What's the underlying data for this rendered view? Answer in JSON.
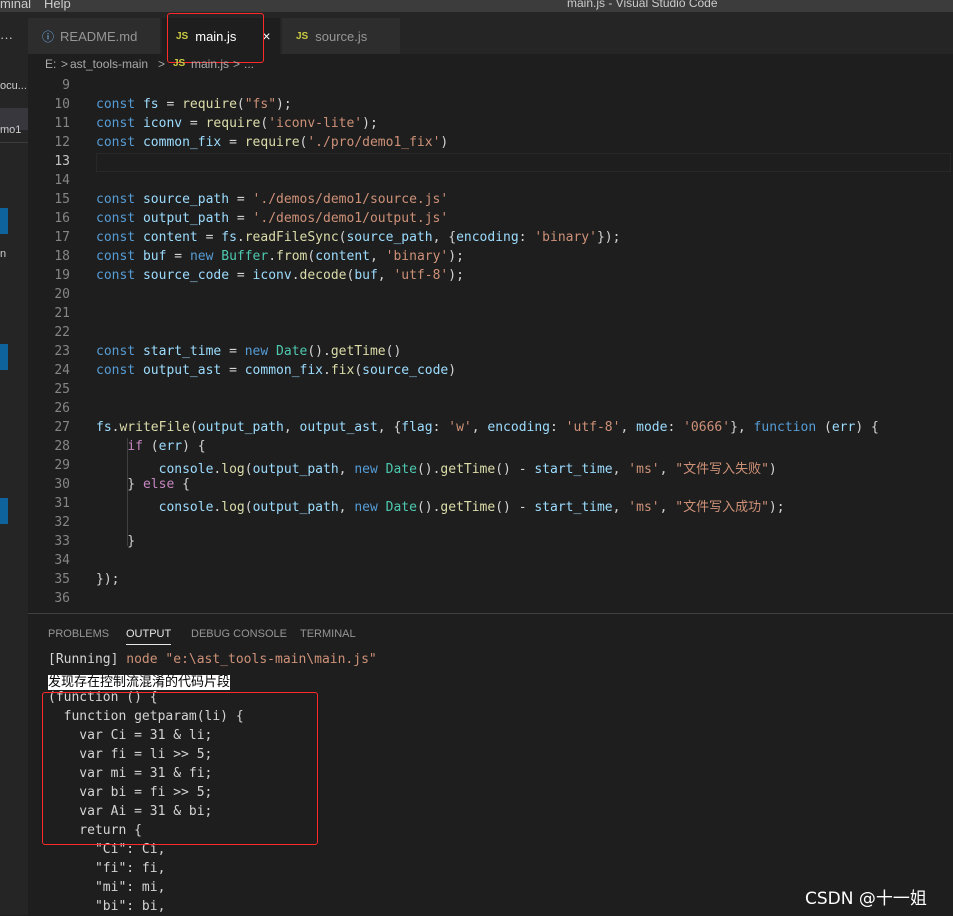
{
  "window": {
    "menu_left": "minal",
    "menu_help": "Help",
    "title": "main.js - Visual Studio Code"
  },
  "activity": {
    "dots": "···",
    "frag1": "ocu...",
    "frag2": "mo1",
    "frag3": "n"
  },
  "tabs": [
    {
      "label": "README.md",
      "icon": "info-icon",
      "icon_glyph": "ⓘ"
    },
    {
      "label": "main.js",
      "icon": "js-file-icon",
      "icon_glyph": "JS",
      "close": "×"
    },
    {
      "label": "source.js",
      "icon": "js-file-icon",
      "icon_glyph": "JS"
    }
  ],
  "breadcrumb": {
    "drive": "E:",
    "sep1": ">",
    "folder": "ast_tools-main",
    "sep2": ">",
    "file_icon": "JS",
    "file": "main.js",
    "sep3": ">",
    "more": "..."
  },
  "editor": {
    "line_numbers": [
      "9",
      "10",
      "11",
      "12",
      "13",
      "14",
      "15",
      "16",
      "17",
      "18",
      "19",
      "20",
      "21",
      "22",
      "23",
      "24",
      "25",
      "26",
      "27",
      "28",
      "29",
      "30",
      "31",
      "32",
      "33",
      "34",
      "35",
      "36"
    ],
    "current_line": "13"
  },
  "panel": {
    "tabs": [
      "PROBLEMS",
      "OUTPUT",
      "DEBUG CONSOLE",
      "TERMINAL"
    ],
    "active_tab": "OUTPUT",
    "running_label": "[Running]",
    "running_cmd": " node \"e:\\ast_tools-main\\main.js\"",
    "highlight_line": "发现存在控制流混淆的代码片段",
    "output_lines": [
      "(function () {",
      "  function getparam(li) {",
      "    var Ci = 31 & li;",
      "    var fi = li >> 5;",
      "    var mi = 31 & fi;",
      "    var bi = fi >> 5;",
      "    var Ai = 31 & bi;",
      "    return {",
      "      \"Ci\": Ci,",
      "      \"fi\": fi,",
      "      \"mi\": mi,",
      "      \"bi\": bi,"
    ]
  },
  "watermark": "CSDN @十一姐",
  "colors": {
    "accent_red": "#ff2a2a",
    "keyword": "#569cd6",
    "string": "#ce9178",
    "variable": "#9cdcfe",
    "function": "#dcdcaa"
  }
}
